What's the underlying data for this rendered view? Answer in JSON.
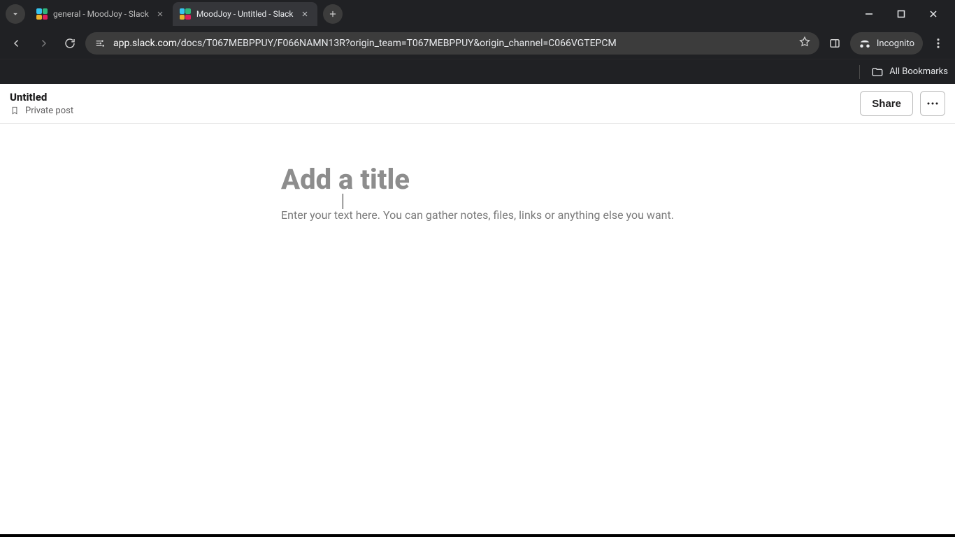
{
  "browser": {
    "tabs": [
      {
        "title": "general - MoodJoy - Slack",
        "active": false
      },
      {
        "title": "MoodJoy - Untitled - Slack",
        "active": true
      }
    ],
    "url_host": "app.slack.com",
    "url_path": "/docs/T067MEBPPUY/F066NAMN13R?origin_team=T067MEBPPUY&origin_channel=C066VGTEPCM",
    "incognito_label": "Incognito",
    "all_bookmarks_label": "All Bookmarks"
  },
  "doc": {
    "header_title": "Untitled",
    "privacy_label": "Private post",
    "share_label": "Share",
    "title_placeholder": "Add a title",
    "body_placeholder": "Enter your text here. You can gather notes, files, links or anything else you want."
  }
}
